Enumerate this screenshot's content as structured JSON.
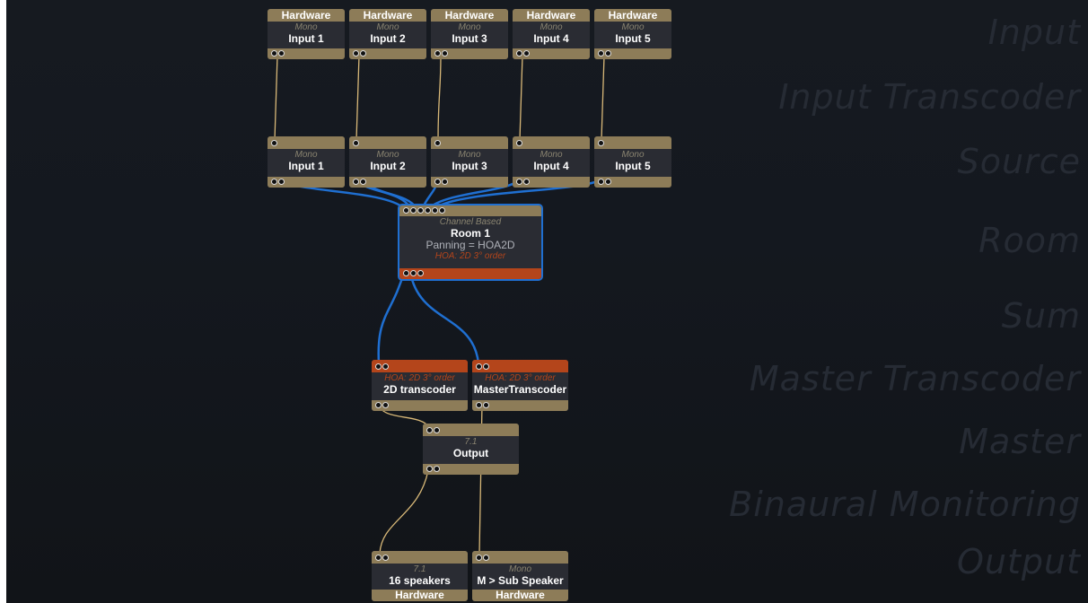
{
  "background_labels": [
    "Input",
    "Input Transcoder",
    "Source",
    "Room",
    "Sum",
    "Master Transcoder",
    "Master",
    "Binaural Monitoring",
    "Output"
  ],
  "hardware_inputs": [
    {
      "header": "Hardware",
      "format": "Mono",
      "name": "Input 1"
    },
    {
      "header": "Hardware",
      "format": "Mono",
      "name": "Input 2"
    },
    {
      "header": "Hardware",
      "format": "Mono",
      "name": "Input 3"
    },
    {
      "header": "Hardware",
      "format": "Mono",
      "name": "Input 4"
    },
    {
      "header": "Hardware",
      "format": "Mono",
      "name": "Input 5"
    }
  ],
  "sources": [
    {
      "format": "Mono",
      "name": "Input 1"
    },
    {
      "format": "Mono",
      "name": "Input 2"
    },
    {
      "format": "Mono",
      "name": "Input 3"
    },
    {
      "format": "Mono",
      "name": "Input 4"
    },
    {
      "format": "Mono",
      "name": "Input 5"
    }
  ],
  "room": {
    "type": "Channel Based",
    "name": "Room 1",
    "panning": "Panning = HOA2D",
    "format": "HOA: 2D 3° order"
  },
  "transcoders": [
    {
      "format": "HOA: 2D 3° order",
      "name": "2D transcoder"
    },
    {
      "format": "HOA: 2D 3° order",
      "name": "MasterTranscoder"
    }
  ],
  "master": {
    "format": "7.1",
    "name": "Output"
  },
  "outputs": [
    {
      "format": "7.1",
      "name": "16 speakers",
      "footer": "Hardware"
    },
    {
      "format": "Mono",
      "name": "M > Sub Speaker",
      "footer": "Hardware"
    }
  ],
  "colors": {
    "node_tan": "#8d7c58",
    "node_orange": "#b4451b",
    "wire_tan": "#d8b878",
    "wire_blue": "#1f6fd1"
  }
}
